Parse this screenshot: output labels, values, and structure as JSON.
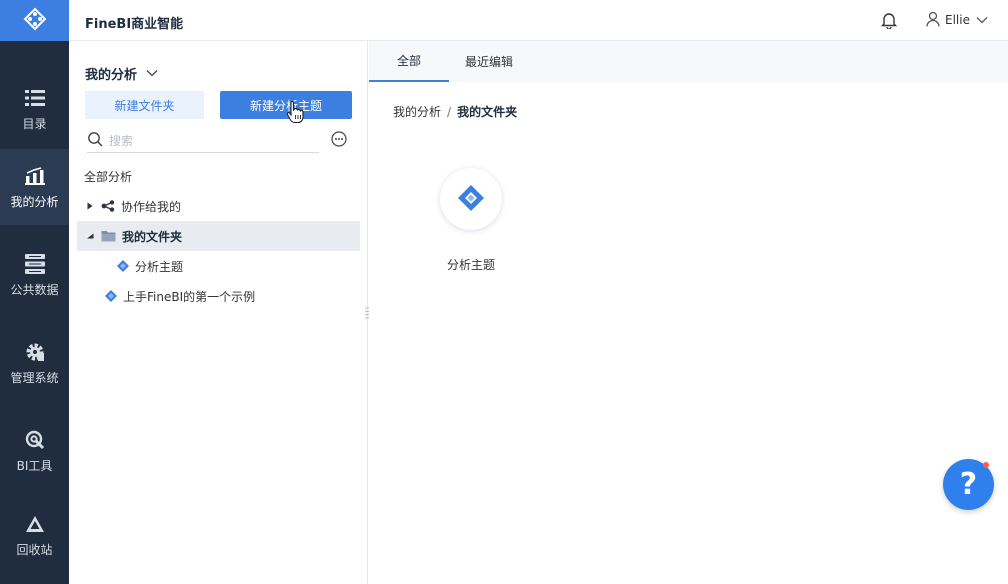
{
  "app": {
    "title": "FineBI商业智能"
  },
  "header": {
    "user_name": "Ellie",
    "bell_icon": "bell-icon",
    "user_icon": "user-icon"
  },
  "nav": {
    "items": [
      {
        "label": "目录",
        "icon": "list-icon"
      },
      {
        "label": "我的分析",
        "icon": "analysis-chart-icon",
        "active": true
      },
      {
        "label": "公共数据",
        "icon": "database-icon"
      },
      {
        "label": "管理系统",
        "icon": "gear-icon"
      },
      {
        "label": "BI工具",
        "icon": "tool-icon"
      },
      {
        "label": "回收站",
        "icon": "recycle-icon"
      }
    ]
  },
  "left_panel": {
    "title": "我的分析",
    "new_folder_label": "新建文件夹",
    "new_theme_label": "新建分析主题",
    "search_placeholder": "搜索",
    "tree_root": "全部分析",
    "tree": [
      {
        "label": "协作给我的",
        "icon": "share-icon"
      },
      {
        "label": "我的文件夹",
        "icon": "folder-icon",
        "selected": true
      },
      {
        "label": "分析主题",
        "icon": "theme-icon"
      },
      {
        "label": "上手FineBI的第一个示例",
        "icon": "theme-icon"
      }
    ]
  },
  "main": {
    "tabs": [
      {
        "label": "全部",
        "active": true
      },
      {
        "label": "最近编辑"
      }
    ],
    "breadcrumb": {
      "parent": "我的分析",
      "separator": "/",
      "current": "我的文件夹"
    },
    "items": [
      {
        "label": "分析主题",
        "icon": "theme-icon"
      }
    ]
  },
  "help": {
    "label": "?"
  },
  "colors": {
    "accent": "#3d7fe0",
    "nav_bg": "#1f2d3f",
    "nav_active": "#2b3b51",
    "help": "#2f80ed"
  }
}
